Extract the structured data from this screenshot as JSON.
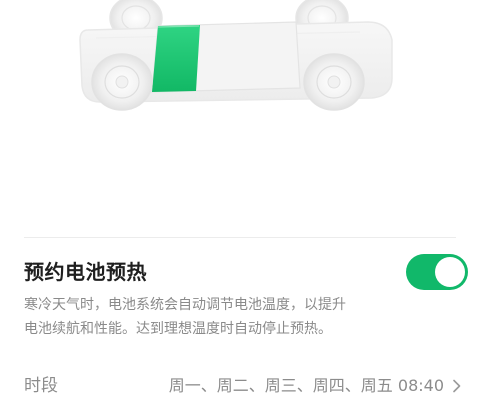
{
  "hero": {
    "illustration": "car-battery-illustration",
    "battery_accent_color": "#1dc971"
  },
  "preheat": {
    "title": "预约电池预热",
    "enabled": true,
    "toggle_color": "#11b86a",
    "description_lines": [
      "寒冷天气时，电池系统会自动调节电池温度，以提升",
      "电池续航和性能。达到理想温度时自动停止预热。"
    ]
  },
  "schedule": {
    "label": "时段",
    "value": "周一、周二、周三、周四、周五 08:40",
    "chevron_icon": "chevron-right-icon"
  }
}
